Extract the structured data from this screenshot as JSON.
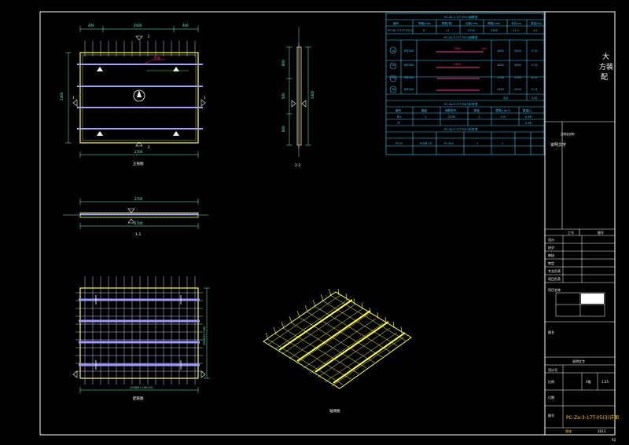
{
  "drawing": {
    "colors": {
      "background": "#000000",
      "frame": "#ffffff",
      "rebar": "#ffff44",
      "rebar_alt": "#9999ff",
      "dimension": "#66ffcc",
      "table": "#33ccff",
      "highlight": "#ff3399",
      "green": "#00ff66",
      "cut_marker": "#ffffff"
    },
    "views": {
      "plan_label": "正视图",
      "section_11_label": "1-1",
      "section_22_label": "2-2",
      "rebar_label": "配筋图",
      "iso_label": "轴测图"
    },
    "plan_dims": {
      "top_left": "400",
      "top_mid": "2000",
      "top_right": "400",
      "bottom": "2700",
      "left_side": "2400",
      "mid_cut_top": "2",
      "mid_cut_bottom": "2",
      "left_cut": "1",
      "right_cut": "1",
      "callout": "桁架"
    },
    "section11_dims": {
      "top": "2700",
      "bottom": "2700"
    },
    "section22_dims": {
      "a": "800",
      "b": "500",
      "c": "800",
      "right": "2400"
    },
    "rebar_dims": {
      "bottom": "100@9+100+20",
      "right": "200@10+200",
      "right2": "200@10+200"
    },
    "table": {
      "title1": "PC-Za-3-17T-05(3)钢筋表",
      "head1": [
        "编号",
        "规格(mm)",
        "根数(根)",
        "长度(mm)",
        "简图(mm)",
        "总长(m)",
        "重量(kg)"
      ],
      "row0": [
        "PC-Za-3-17T-05(3)",
        "8",
        "11",
        "2700",
        "2400",
        "11.5",
        "4.5"
      ],
      "rows": [
        {
          "id": "1a",
          "spec": "8@200",
          "len": "2600",
          "total": "2600",
          "w": "0.21"
        },
        {
          "id": "2a",
          "spec": "8@200",
          "len": "2600",
          "total": "2800",
          "w": "0.21"
        },
        {
          "id": "3a",
          "spec": "8@200",
          "len": "2700",
          "total": "2700",
          "w": "0.21"
        },
        {
          "id": "3b",
          "spec": "8@200",
          "len": "2400",
          "total": "2000",
          "w": "0.21"
        }
      ],
      "shape_label_1": "2400",
      "shape_label_2": "120",
      "sum_label": "合计",
      "sum_val": "0.81",
      "title2": "PC-Za-3-17T-05(3)构件表",
      "head2": [
        "编号",
        "截面",
        "钢筋型号",
        "数量",
        "混凝土(m3)",
        "重量(t)"
      ],
      "row2a": [
        "BH",
        "1",
        "2400",
        "1",
        "0.6",
        "0.48"
      ],
      "row2b": [
        "TF",
        "",
        "",
        "",
        "",
        "0.48"
      ],
      "title3": "PC-Za-3-17T-05(3)构件表",
      "head3": [
        "",
        "",
        "",
        "",
        "",
        "",
        "",
        ""
      ],
      "row3": [
        "PC03",
        "PCKB-25",
        "P=300",
        "1",
        "1",
        "",
        "",
        ""
      ],
      "note_cap": "注明及说明",
      "note": "说明文字"
    },
    "title_block": {
      "top_char_1": "大",
      "top_char_2": "方装",
      "top_char_3": "配",
      "cells_top": [
        "工号",
        "图号"
      ],
      "labels": [
        "设计",
        "校对",
        "审核",
        "审定",
        "专业负责",
        "项目负责",
        "设计号"
      ],
      "mid_caption": "项目名称",
      "scale_label": "比例",
      "scale": "1:25",
      "rev": "A版",
      "sheet_name_caption": "图名",
      "drawing_name": "PC-Za-3-17T-05(3)详图",
      "drawing_no": "图号",
      "drawing_no_val": "2013",
      "bottom_left": "建施",
      "date": "日期",
      "page": "A2"
    }
  }
}
